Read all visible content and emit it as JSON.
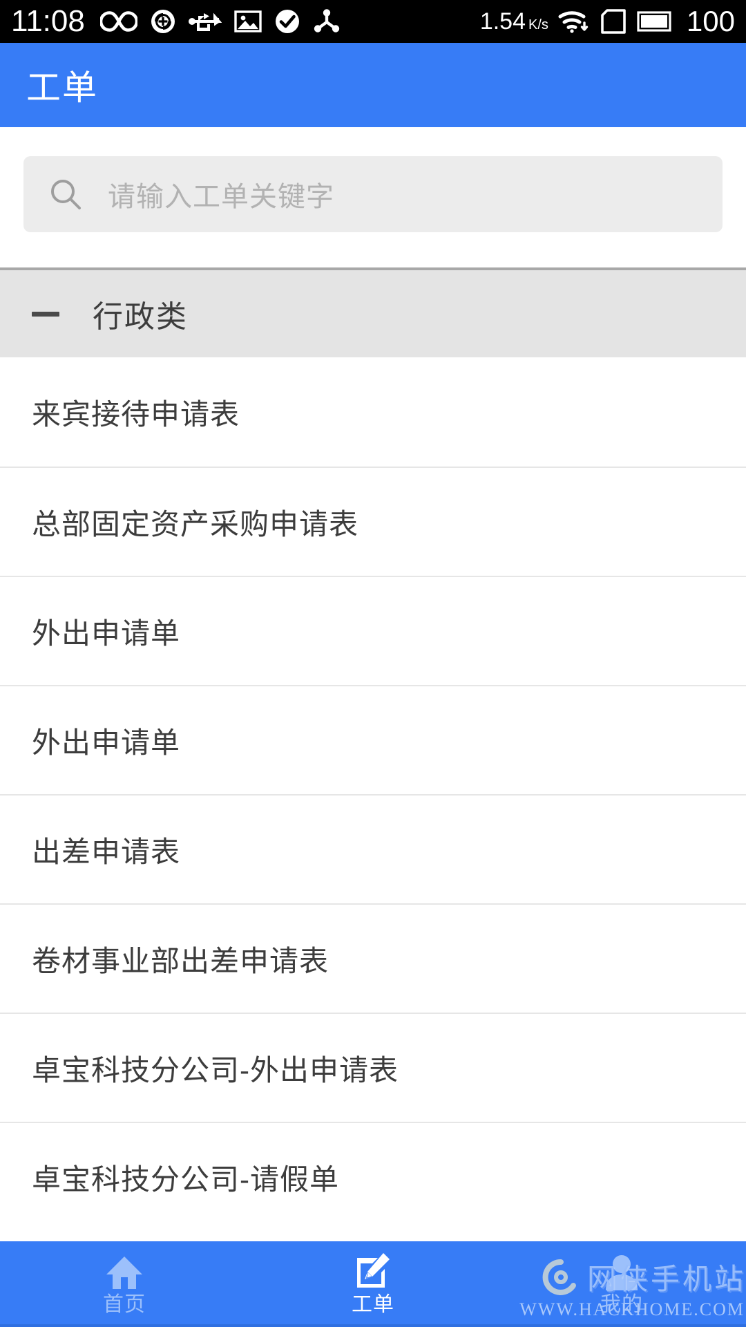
{
  "statusbar": {
    "clock": "11:08",
    "network_speed": "1.54",
    "network_speed_unit": "K/s",
    "battery_percent": "100",
    "icons": [
      "infinity-icon",
      "sync-plus-icon",
      "usb-icon",
      "gallery-icon",
      "check-circle-icon",
      "share-nodes-icon",
      "wifi-download-icon",
      "sim-card-icon",
      "battery-icon"
    ]
  },
  "header": {
    "title": "工单"
  },
  "search": {
    "placeholder": "请输入工单关键字",
    "value": ""
  },
  "group": {
    "label": "行政类",
    "expanded": true,
    "toggle_icon": "minus-icon"
  },
  "list": {
    "items": [
      {
        "label": "来宾接待申请表"
      },
      {
        "label": "总部固定资产采购申请表"
      },
      {
        "label": "外出申请单"
      },
      {
        "label": "外出申请单"
      },
      {
        "label": "出差申请表"
      },
      {
        "label": "卷材事业部出差申请表"
      },
      {
        "label": "卓宝科技分公司-外出申请表"
      },
      {
        "label": "卓宝科技分公司-请假单"
      }
    ]
  },
  "bottomnav": {
    "items": [
      {
        "label": "首页",
        "icon": "home-icon",
        "active": false
      },
      {
        "label": "工单",
        "icon": "edit-note-icon",
        "active": true
      },
      {
        "label": "我的",
        "icon": "person-icon",
        "active": false
      }
    ]
  },
  "watermark": {
    "cn": "网侠手机站",
    "url": "WWW.HACKHOME.COM"
  },
  "colors": {
    "accent_blue": "#377CF6",
    "statusbar_bg": "#000000",
    "group_bg": "#e4e4e4",
    "search_bg": "#ececec",
    "text_primary": "#3c3c3c",
    "text_placeholder": "#b2b2b2",
    "nav_inactive": "#9cc0fb"
  }
}
